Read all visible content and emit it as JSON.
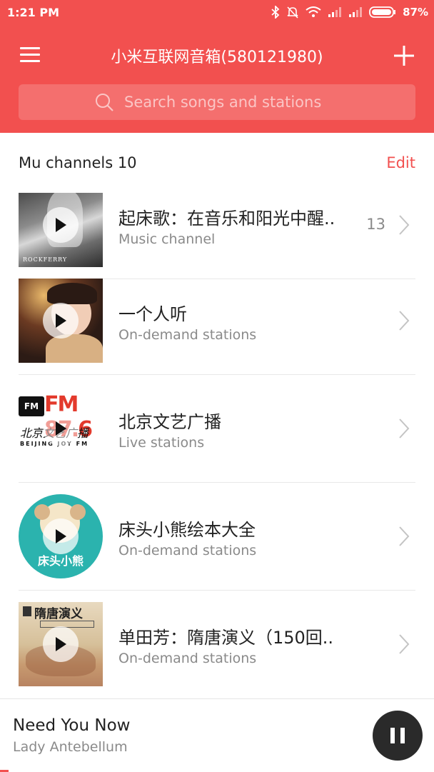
{
  "status_bar": {
    "time": "1:21 PM",
    "battery": "87%"
  },
  "header": {
    "title": "小米互联网音箱(580121980)"
  },
  "search": {
    "placeholder": "Search songs and stations"
  },
  "section": {
    "title": "Mu channels 10",
    "edit_label": "Edit"
  },
  "channels": [
    {
      "title": "起床歌：在音乐和阳光中醒..",
      "subtitle": "Music channel",
      "count": "13",
      "thumb_text": "ROCKFERRY"
    },
    {
      "title": "一个人听",
      "subtitle": "On-demand stations"
    },
    {
      "title": "北京文艺广播",
      "subtitle": "Live stations",
      "thumb_text": "FM 87.6",
      "thumb_caption": "北京文艺广播",
      "thumb_footer": "BEIJING JOY FM"
    },
    {
      "title": "床头小熊绘本大全",
      "subtitle": "On-demand stations",
      "thumb_text": "床头小熊"
    },
    {
      "title": "单田芳：隋唐演义（150回..",
      "subtitle": "On-demand stations",
      "thumb_text": "隋唐演义"
    }
  ],
  "player": {
    "song": "Need You Now",
    "artist": "Lady Antebellum"
  },
  "colors": {
    "accent": "#f2504f",
    "text": "#222222",
    "secondary": "#8a8a8a"
  }
}
